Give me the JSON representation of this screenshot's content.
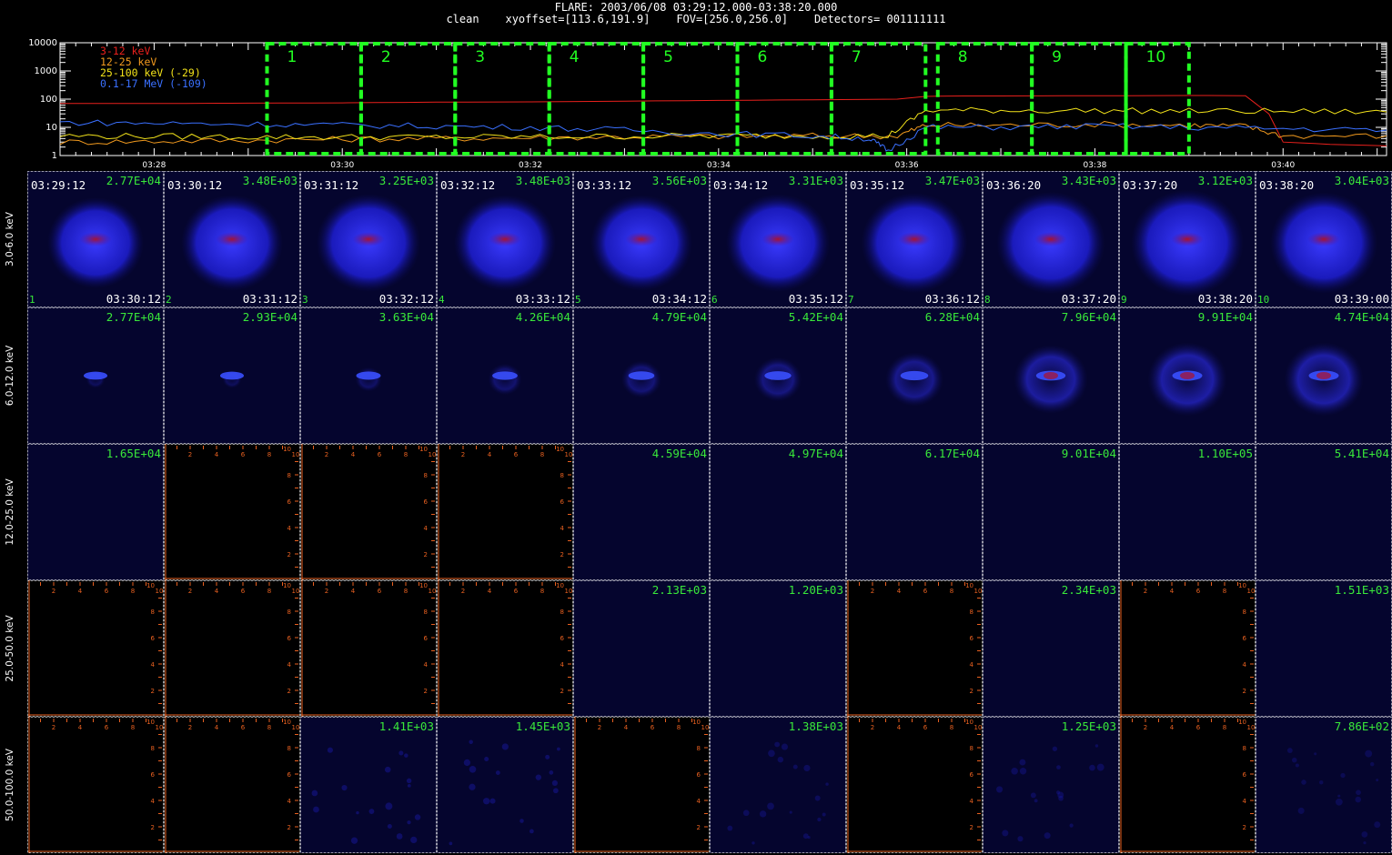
{
  "header": {
    "line1": "FLARE: 2003/06/08 03:29:12.000-03:38:20.000",
    "line2": "clean    xyoffset=[113.6,191.9]    FOV=[256.0,256.0]    Detectors= 001111111"
  },
  "chart_data": [
    {
      "type": "line",
      "title": "",
      "xlabel": "",
      "ylabel": "",
      "yscale": "log",
      "ylim": [
        1,
        10000
      ],
      "y_tick_labels": [
        "1",
        "10",
        "100",
        "1000",
        "10000"
      ],
      "x_tick_labels": [
        "03:28",
        "03:30",
        "03:32",
        "03:34",
        "03:36",
        "03:38",
        "03:40"
      ],
      "x_minutes_range": [
        27.0,
        41.1
      ],
      "legend_position": "top-left",
      "series": [
        {
          "name": "3-12 keV",
          "color": "#e8201c",
          "x": [
            27.0,
            28.0,
            29.0,
            30.0,
            31.0,
            32.0,
            33.0,
            34.0,
            35.0,
            35.9,
            36.2,
            36.6,
            37.0,
            38.0,
            39.0,
            39.6,
            39.85,
            40.0,
            40.5,
            41.1
          ],
          "y": [
            70,
            70,
            72,
            74,
            78,
            80,
            85,
            90,
            95,
            100,
            125,
            130,
            130,
            132,
            135,
            133,
            30,
            3,
            2.5,
            2.2
          ]
        },
        {
          "name": "12-25 keV",
          "color": "#f29a1e",
          "x": [
            27.0,
            28.0,
            29.0,
            30.0,
            31.0,
            32.0,
            33.0,
            34.0,
            35.0,
            35.9,
            36.2,
            37.0,
            38.0,
            39.0,
            39.6,
            40.0,
            41.1
          ],
          "y": [
            3,
            3.2,
            3.5,
            3.8,
            4,
            4.3,
            4.6,
            4.8,
            5,
            5,
            12,
            12,
            13,
            12,
            11,
            5,
            5
          ]
        },
        {
          "name": "25-100 keV (-29)",
          "color": "#f2e21a",
          "x": [
            27.0,
            28.0,
            29.0,
            30.0,
            31.0,
            32.0,
            33.0,
            34.0,
            35.0,
            35.8,
            36.2,
            37.0,
            38.0,
            39.0,
            40.0,
            41.1
          ],
          "y": [
            5,
            4.8,
            4.6,
            4.5,
            4.5,
            4.6,
            4.8,
            5,
            5,
            5,
            40,
            40,
            39,
            38,
            37,
            35
          ]
        },
        {
          "name": "0.1-17 MeV (-109)",
          "color": "#3a70ff",
          "x": [
            27.0,
            28.0,
            29.0,
            30.0,
            31.0,
            32.0,
            33.0,
            34.0,
            35.0,
            35.6,
            35.8,
            36.2,
            37.0,
            38.0,
            39.0,
            40.0,
            41.1
          ],
          "y": [
            15,
            14,
            13,
            12,
            11,
            10,
            8,
            6,
            5,
            4,
            1.5,
            10,
            10,
            11,
            10,
            9,
            8
          ]
        }
      ],
      "intervals": [
        {
          "label": "1",
          "start": 29.2,
          "end": 30.2
        },
        {
          "label": "2",
          "start": 30.2,
          "end": 31.2
        },
        {
          "label": "3",
          "start": 31.2,
          "end": 32.2
        },
        {
          "label": "4",
          "start": 32.2,
          "end": 33.2
        },
        {
          "label": "5",
          "start": 33.2,
          "end": 34.2
        },
        {
          "label": "6",
          "start": 34.2,
          "end": 35.2
        },
        {
          "label": "7",
          "start": 35.2,
          "end": 36.2
        },
        {
          "label": "8",
          "start": 36.33,
          "end": 37.33
        },
        {
          "label": "9",
          "start": 37.33,
          "end": 38.33
        },
        {
          "label": "10",
          "start": 38.33,
          "end": 39.0
        }
      ]
    },
    {
      "type": "heatmap",
      "colors": {
        "image_bg": "#05052e",
        "empty_bg": "#000000",
        "empty_axis": "#e86020",
        "value_text": "#39e83a",
        "time_text": "#ffffff",
        "panel_border": "#ffffff"
      },
      "energy_bands": [
        "3.0-6.0 keV",
        "6.0-12.0 keV",
        "12.0-25.0 keV",
        "25.0-50.0 keV",
        "50.0-100.0 keV"
      ],
      "columns": [
        {
          "index": "1",
          "start": "03:29:12",
          "end": "03:30:12"
        },
        {
          "index": "2",
          "start": "03:30:12",
          "end": "03:31:12"
        },
        {
          "index": "3",
          "start": "03:31:12",
          "end": "03:32:12"
        },
        {
          "index": "4",
          "start": "03:32:12",
          "end": "03:33:12"
        },
        {
          "index": "5",
          "start": "03:33:12",
          "end": "03:34:12"
        },
        {
          "index": "6",
          "start": "03:34:12",
          "end": "03:35:12"
        },
        {
          "index": "7",
          "start": "03:35:12",
          "end": "03:36:12"
        },
        {
          "index": "8",
          "start": "03:36:20",
          "end": "03:37:20"
        },
        {
          "index": "9",
          "start": "03:37:20",
          "end": "03:38:20"
        },
        {
          "index": "10",
          "start": "03:38:20",
          "end": "03:39:00"
        }
      ],
      "max_values": [
        [
          "2.77E+04",
          "3.48E+03",
          "3.25E+03",
          "3.48E+03",
          "3.56E+03",
          "3.31E+03",
          "3.47E+03",
          "3.43E+03",
          "3.12E+03",
          "3.04E+03"
        ],
        [
          "2.77E+04",
          "2.93E+04",
          "3.63E+04",
          "4.26E+04",
          "4.79E+04",
          "5.42E+04",
          "6.28E+04",
          "7.96E+04",
          "9.91E+04",
          "4.74E+04"
        ],
        [
          "1.65E+04",
          null,
          null,
          null,
          "4.59E+04",
          "4.97E+04",
          "6.17E+04",
          "9.01E+04",
          "1.10E+05",
          "5.41E+04"
        ],
        [
          null,
          null,
          null,
          null,
          "2.13E+03",
          "1.20E+03",
          null,
          "2.34E+03",
          null,
          "1.51E+03"
        ],
        [
          null,
          null,
          "1.41E+03",
          "1.45E+03",
          null,
          "1.38E+03",
          null,
          "1.25E+03",
          null,
          "7.86E+02"
        ]
      ],
      "source_brightness": [
        [
          0.75,
          0.8,
          0.82,
          0.8,
          0.8,
          0.82,
          0.84,
          0.86,
          0.9,
          0.85
        ],
        [
          0.18,
          0.18,
          0.25,
          0.32,
          0.38,
          0.45,
          0.55,
          0.7,
          0.75,
          0.75
        ],
        [
          0,
          0,
          0,
          0,
          0,
          0,
          0,
          0,
          0,
          0
        ],
        [
          0,
          0,
          0,
          0,
          0,
          0,
          0,
          0,
          0,
          0
        ],
        [
          0,
          0,
          0.15,
          0.15,
          0,
          0.12,
          0,
          0.12,
          0,
          0.1
        ]
      ],
      "empty_axis_ticks": [
        "2",
        "4",
        "6",
        "8",
        "10"
      ]
    }
  ]
}
